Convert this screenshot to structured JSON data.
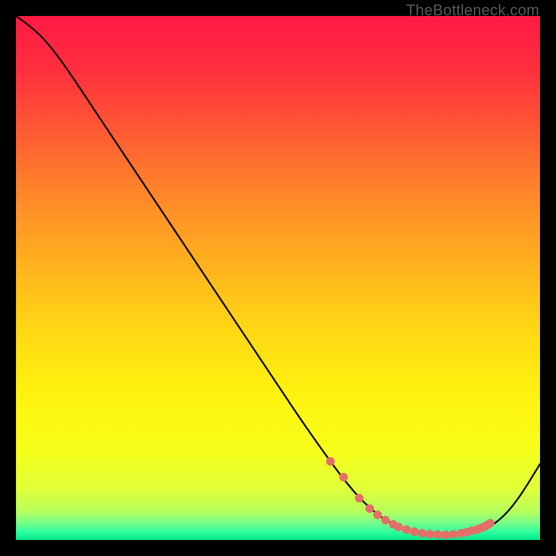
{
  "watermark": "TheBottleneck.com",
  "chart_data": {
    "type": "line",
    "title": "",
    "xlabel": "",
    "ylabel": "",
    "xlim": [
      0,
      100
    ],
    "ylim": [
      0,
      100
    ],
    "background": {
      "type": "vertical-gradient",
      "stops": [
        {
          "pos": 0.0,
          "color": "#ff1a44"
        },
        {
          "pos": 0.1,
          "color": "#ff2e3e"
        },
        {
          "pos": 0.22,
          "color": "#ff5a33"
        },
        {
          "pos": 0.35,
          "color": "#ff8a28"
        },
        {
          "pos": 0.48,
          "color": "#ffb31d"
        },
        {
          "pos": 0.6,
          "color": "#ffd814"
        },
        {
          "pos": 0.72,
          "color": "#fff20f"
        },
        {
          "pos": 0.83,
          "color": "#f6ff1a"
        },
        {
          "pos": 0.9,
          "color": "#e2ff38"
        },
        {
          "pos": 0.945,
          "color": "#b8ff5b"
        },
        {
          "pos": 0.965,
          "color": "#7fff86"
        },
        {
          "pos": 0.985,
          "color": "#2effa0"
        },
        {
          "pos": 1.0,
          "color": "#00e58a"
        }
      ]
    },
    "series": [
      {
        "name": "curve",
        "color": "#000000",
        "x": [
          0.0,
          2.5,
          5.0,
          7.5,
          10.0,
          12.5,
          15.0,
          20.0,
          25.0,
          30.0,
          35.0,
          40.0,
          45.0,
          50.0,
          55.0,
          60.0,
          63.0,
          66.0,
          70.0,
          74.0,
          78.0,
          82.0,
          86.0,
          90.0,
          93.0,
          96.0,
          100.0
        ],
        "y": [
          100.0,
          98.2,
          96.0,
          93.0,
          89.5,
          85.8,
          82.0,
          74.5,
          67.0,
          59.5,
          52.0,
          44.5,
          37.0,
          29.5,
          22.0,
          15.0,
          11.0,
          7.5,
          4.0,
          2.0,
          1.2,
          1.0,
          1.2,
          2.2,
          4.4,
          8.0,
          14.5
        ]
      }
    ],
    "markers": {
      "name": "dots",
      "color": "#e36f68",
      "radius_px": 6.2,
      "x": [
        60.0,
        62.5,
        65.5,
        67.5,
        69.0,
        70.5,
        72.0,
        73.0,
        74.5,
        76.0,
        77.5,
        79.0,
        80.5,
        82.0,
        83.5,
        85.0,
        86.0,
        87.0,
        88.0,
        88.5,
        89.0
      ],
      "y": [
        15.0,
        12.0,
        8.0,
        6.0,
        4.8,
        3.8,
        3.0,
        2.5,
        2.0,
        1.6,
        1.3,
        1.15,
        1.05,
        1.0,
        1.1,
        1.3,
        1.5,
        1.8,
        2.0,
        2.2,
        2.4
      ]
    },
    "markers2": {
      "name": "dots-upper",
      "color": "#e36f68",
      "radius_px": 6.2,
      "x": [
        89.5,
        90.0,
        90.5
      ],
      "y": [
        2.6,
        2.9,
        3.2
      ]
    }
  }
}
